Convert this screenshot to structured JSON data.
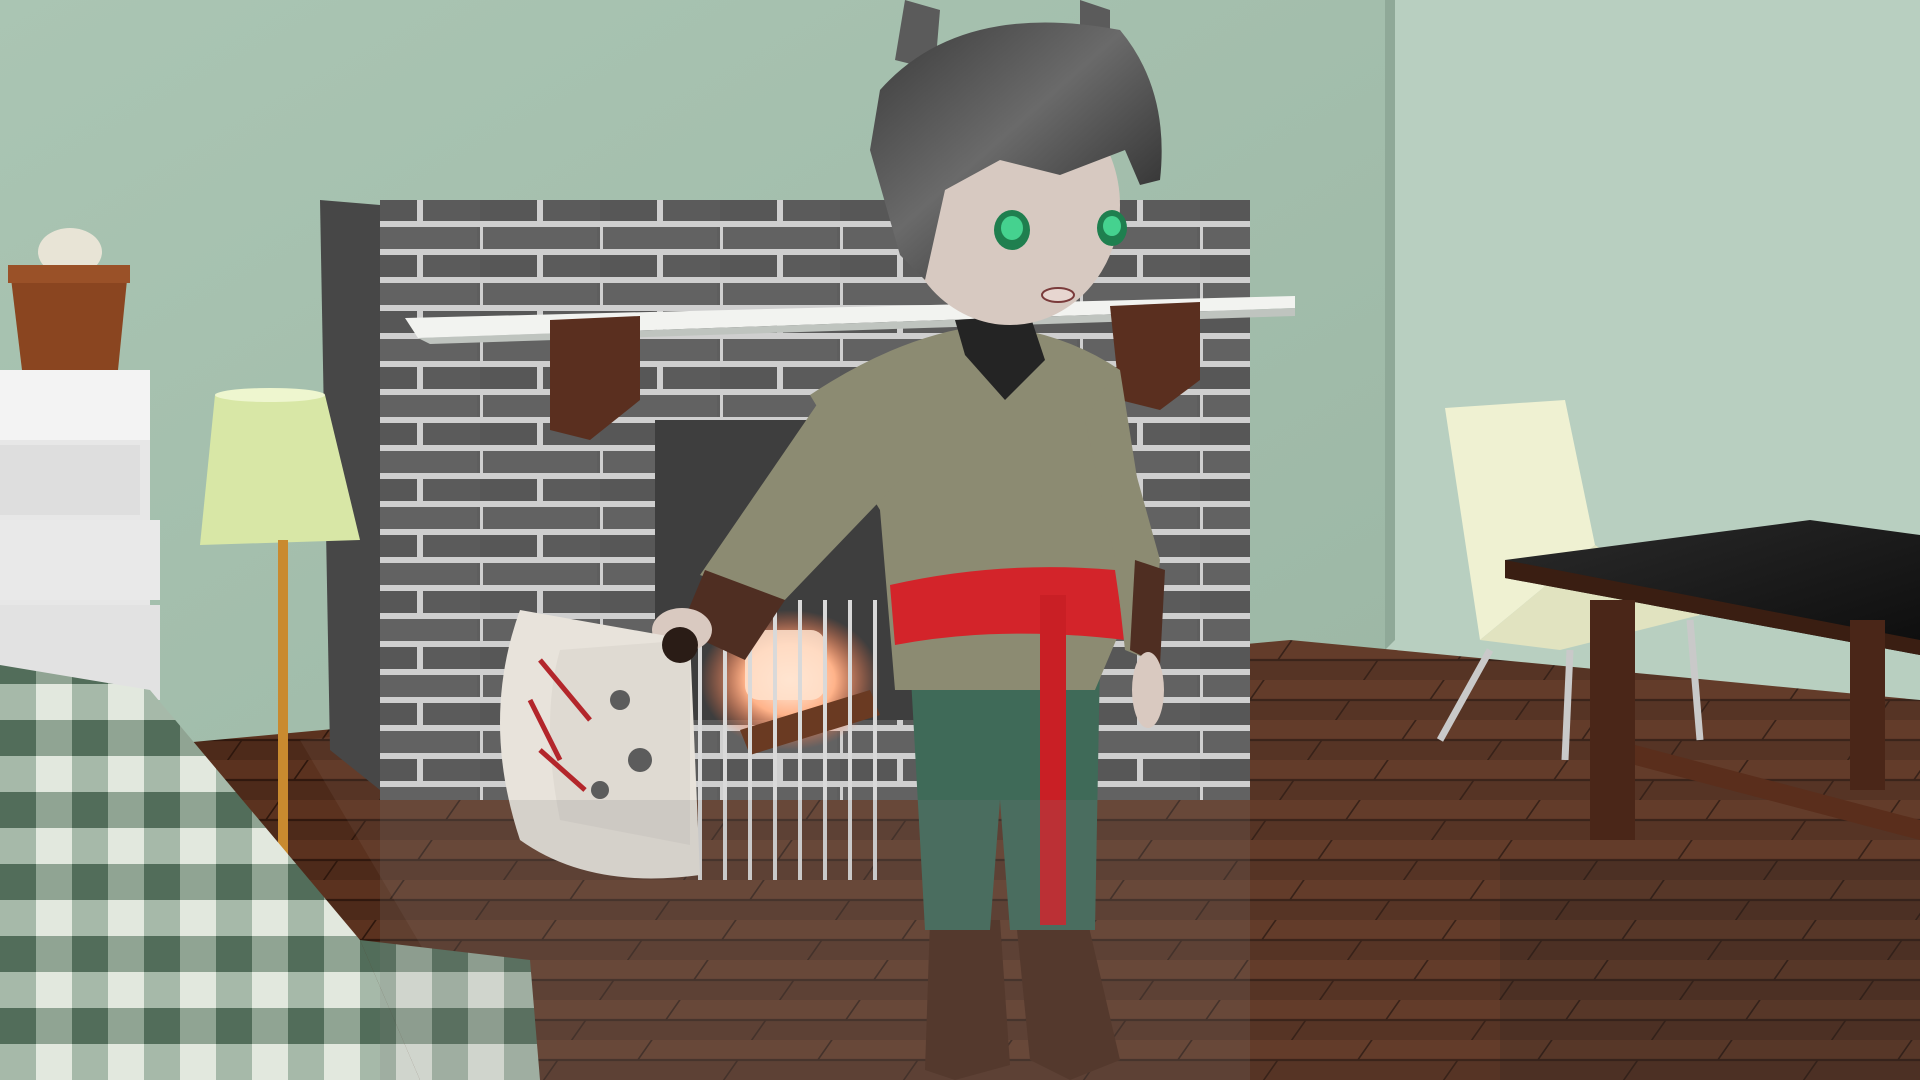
{
  "scene": {
    "kind": "3d-render",
    "palette": {
      "wall": "#a9c4b1",
      "wall_shadow": "#7f9a88",
      "side_wall": "#b7cfbf",
      "floor": "#4a2a1a",
      "floor_light": "#6a3a22",
      "brick": "#5d5d5d",
      "mortar": "#c8c8c8",
      "mantel": "#e9ece8",
      "corbel": "#5a2f1f",
      "fire": "#ffd7b8",
      "lamp_shade": "#d8e7a6",
      "lamp_pole": "#c98a2f",
      "pot": "#8a4520",
      "dresser": "#e6e6e6",
      "bedspread_green": "#4f6f57",
      "bedspread_light": "#dfe7dd",
      "chair": "#f0f2d8",
      "table_top": "#1c1c1c",
      "table_wood": "#4a2618",
      "hair": "#2a2a2a",
      "skin": "#d8c8c0",
      "eyes": "#34c07a",
      "tunic": "#8b8b72",
      "sleeve": "#4e2e22",
      "sash": "#d4242a",
      "pants": "#3f6a58",
      "boots": "#4a2a1c",
      "fan_paper": "#e9e4dc",
      "fan_blossom": "#b3262b"
    },
    "objects": [
      "green-wall",
      "brick-fireplace",
      "fireplace-fire",
      "white-mantel",
      "floor-lamp",
      "potted-cactus",
      "white-dresser",
      "plaid-bed",
      "white-chair",
      "dark-dining-table",
      "wooden-floor",
      "cat-eared-child-character",
      "painted-folding-fan"
    ]
  }
}
